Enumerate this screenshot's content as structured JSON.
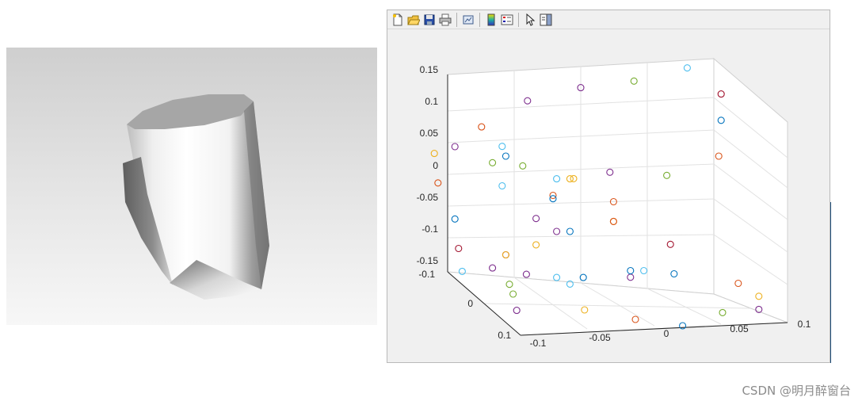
{
  "render_panel": {
    "background_top": "#cfcfcf",
    "background_bottom": "#f7f7f7",
    "object": "shaded-cylinder-with-cut"
  },
  "figure_window": {
    "toolbar": [
      {
        "name": "new-figure-icon"
      },
      {
        "name": "open-file-icon"
      },
      {
        "name": "save-icon"
      },
      {
        "name": "print-icon"
      },
      {
        "separator": true
      },
      {
        "name": "link-plot-icon"
      },
      {
        "separator": true
      },
      {
        "name": "colorbar-icon"
      },
      {
        "name": "legend-icon"
      },
      {
        "separator": true
      },
      {
        "name": "pointer-icon"
      },
      {
        "name": "property-editor-icon"
      }
    ]
  },
  "axes_labels": {
    "z_ticks": [
      "0.15",
      "0.1",
      "0.05",
      "0",
      "-0.05",
      "-0.1",
      "-0.15"
    ],
    "y_ticks": [
      "-0.1",
      "0",
      "0.1"
    ],
    "x_ticks": [
      "-0.1",
      "-0.05",
      "0",
      "0.05",
      "0.1"
    ]
  },
  "chart_data": {
    "type": "scatter",
    "marker": "circle-open",
    "view": "3d",
    "grid": true,
    "xlim": [
      -0.1,
      0.1
    ],
    "ylim": [
      -0.1,
      0.1
    ],
    "zlim": [
      -0.15,
      0.15
    ],
    "point_colors": [
      "#0072BD",
      "#D95319",
      "#EDB120",
      "#7E2F8E",
      "#77AC30",
      "#4DBEEE",
      "#A2142F"
    ],
    "points": [
      {
        "x": -0.04,
        "y": -0.1,
        "z": 0.11,
        "c": 3
      },
      {
        "x": 0.0,
        "y": -0.1,
        "z": 0.13,
        "c": 3
      },
      {
        "x": 0.04,
        "y": -0.1,
        "z": 0.14,
        "c": 4
      },
      {
        "x": 0.08,
        "y": -0.1,
        "z": 0.16,
        "c": 5
      },
      {
        "x": 0.1,
        "y": -0.08,
        "z": 0.13,
        "c": 6
      },
      {
        "x": 0.1,
        "y": -0.08,
        "z": 0.09,
        "c": 0
      },
      {
        "x": 0.09,
        "y": -0.05,
        "z": 0.05,
        "c": 1
      },
      {
        "x": -0.08,
        "y": -0.08,
        "z": 0.08,
        "c": 1
      },
      {
        "x": -0.1,
        "y": -0.08,
        "z": 0.05,
        "c": 3
      },
      {
        "x": -0.11,
        "y": -0.1,
        "z": 0.03,
        "c": 2
      },
      {
        "x": -0.08,
        "y": -0.05,
        "z": 0.04,
        "c": 4
      },
      {
        "x": -0.07,
        "y": -0.06,
        "z": 0.06,
        "c": 5
      },
      {
        "x": -0.07,
        "y": -0.05,
        "z": 0.05,
        "c": 0
      },
      {
        "x": -0.06,
        "y": -0.04,
        "z": 0.04,
        "c": 4
      },
      {
        "x": -0.04,
        "y": -0.02,
        "z": 0.03,
        "c": 5
      },
      {
        "x": -0.03,
        "y": -0.02,
        "z": 0.03,
        "c": 2
      },
      {
        "x": -0.03,
        "y": -0.01,
        "z": 0.035,
        "c": 2
      },
      {
        "x": 0.0,
        "y": -0.02,
        "z": 0.04,
        "c": 3
      },
      {
        "x": 0.04,
        "y": -0.01,
        "z": 0.04,
        "c": 4
      },
      {
        "x": -0.11,
        "y": -0.09,
        "z": -0.01,
        "c": 1
      },
      {
        "x": -0.07,
        "y": -0.06,
        "z": 0.0,
        "c": 5
      },
      {
        "x": -0.04,
        "y": -0.03,
        "z": 0.0,
        "c": 1
      },
      {
        "x": -0.04,
        "y": -0.03,
        "z": -0.005,
        "c": 0
      },
      {
        "x": 0.0,
        "y": -0.01,
        "z": 0.0,
        "c": 1
      },
      {
        "x": -0.05,
        "y": -0.04,
        "z": -0.04,
        "c": 3
      },
      {
        "x": -0.04,
        "y": -0.02,
        "z": -0.05,
        "c": 3
      },
      {
        "x": -0.03,
        "y": -0.02,
        "z": -0.05,
        "c": 0
      },
      {
        "x": 0.0,
        "y": -0.01,
        "z": -0.03,
        "c": 2
      },
      {
        "x": 0.0,
        "y": -0.01,
        "z": -0.03,
        "c": 1
      },
      {
        "x": -0.1,
        "y": -0.08,
        "z": -0.06,
        "c": 0
      },
      {
        "x": 0.04,
        "y": 0.0,
        "z": -0.06,
        "c": 6
      },
      {
        "x": -0.1,
        "y": -0.07,
        "z": -0.1,
        "c": 6
      },
      {
        "x": -0.07,
        "y": -0.05,
        "z": -0.1,
        "c": 6
      },
      {
        "x": -0.07,
        "y": -0.05,
        "z": -0.1,
        "c": 2
      },
      {
        "x": -0.05,
        "y": -0.04,
        "z": -0.08,
        "c": 2
      },
      {
        "x": -0.1,
        "y": -0.06,
        "z": -0.13,
        "c": 5
      },
      {
        "x": -0.08,
        "y": -0.05,
        "z": -0.12,
        "c": 3
      },
      {
        "x": -0.07,
        "y": -0.04,
        "z": -0.14,
        "c": 4
      },
      {
        "x": -0.06,
        "y": -0.03,
        "z": -0.12,
        "c": 3
      },
      {
        "x": -0.04,
        "y": -0.02,
        "z": -0.12,
        "c": 5
      },
      {
        "x": -0.03,
        "y": -0.02,
        "z": -0.13,
        "c": 5
      },
      {
        "x": -0.02,
        "y": -0.02,
        "z": -0.12,
        "c": 0
      },
      {
        "x": 0.01,
        "y": 0.0,
        "z": -0.11,
        "c": 3
      },
      {
        "x": 0.01,
        "y": 0.0,
        "z": -0.1,
        "c": 0
      },
      {
        "x": 0.02,
        "y": 0.0,
        "z": -0.1,
        "c": 5
      },
      {
        "x": 0.04,
        "y": 0.01,
        "z": -0.1,
        "c": 0
      },
      {
        "x": 0.08,
        "y": 0.04,
        "z": -0.1,
        "c": 1
      },
      {
        "x": 0.09,
        "y": 0.06,
        "z": -0.11,
        "c": 2
      },
      {
        "x": 0.09,
        "y": 0.06,
        "z": -0.13,
        "c": 3
      },
      {
        "x": -0.07,
        "y": -0.03,
        "z": -0.15,
        "c": 4
      },
      {
        "x": -0.07,
        "y": -0.02,
        "z": -0.17,
        "c": 3
      },
      {
        "x": -0.03,
        "y": 0.02,
        "z": -0.15,
        "c": 2
      },
      {
        "x": 0.0,
        "y": 0.05,
        "z": -0.15,
        "c": 1
      },
      {
        "x": 0.03,
        "y": 0.07,
        "z": -0.15,
        "c": 0
      },
      {
        "x": 0.06,
        "y": 0.07,
        "z": -0.13,
        "c": 4
      }
    ]
  },
  "watermark": "CSDN @明月醉窗台"
}
